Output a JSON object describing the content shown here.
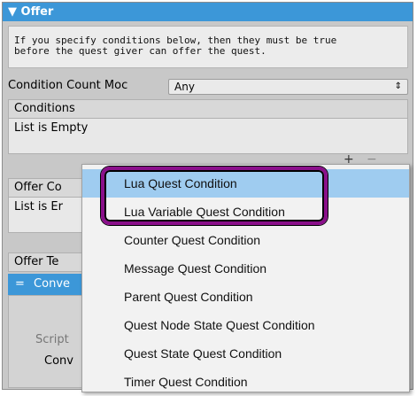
{
  "panel": {
    "title": "▼ Offer",
    "help_text": "If you specify conditions below, then they must be true\nbefore the quest giver can offer the quest."
  },
  "condition_count": {
    "label": "Condition Count Moc",
    "value": "Any",
    "arrow": "⇕"
  },
  "conditions_list": {
    "header": "Conditions",
    "empty_text": "List is Empty",
    "add": "+",
    "remove": "−"
  },
  "offer_conditions_list": {
    "header": "Offer Co",
    "empty_text": "List is Er"
  },
  "offer_text_list": {
    "header": "Offer Te",
    "item_label": "Conve",
    "handle": "="
  },
  "script": {
    "label": "Script",
    "value": "Conv"
  },
  "menu": {
    "items": [
      "Lua Quest Condition",
      "Lua Variable Quest Condition",
      "Counter Quest Condition",
      "Message Quest Condition",
      "Parent Quest Condition",
      "Quest Node State Quest Condition",
      "Quest State Quest Condition",
      "Timer Quest Condition"
    ]
  },
  "colors": {
    "header_blue": "#3c97d8",
    "menu_highlight": "#9fccf0",
    "annotation_ring": "#8a0f8a"
  }
}
